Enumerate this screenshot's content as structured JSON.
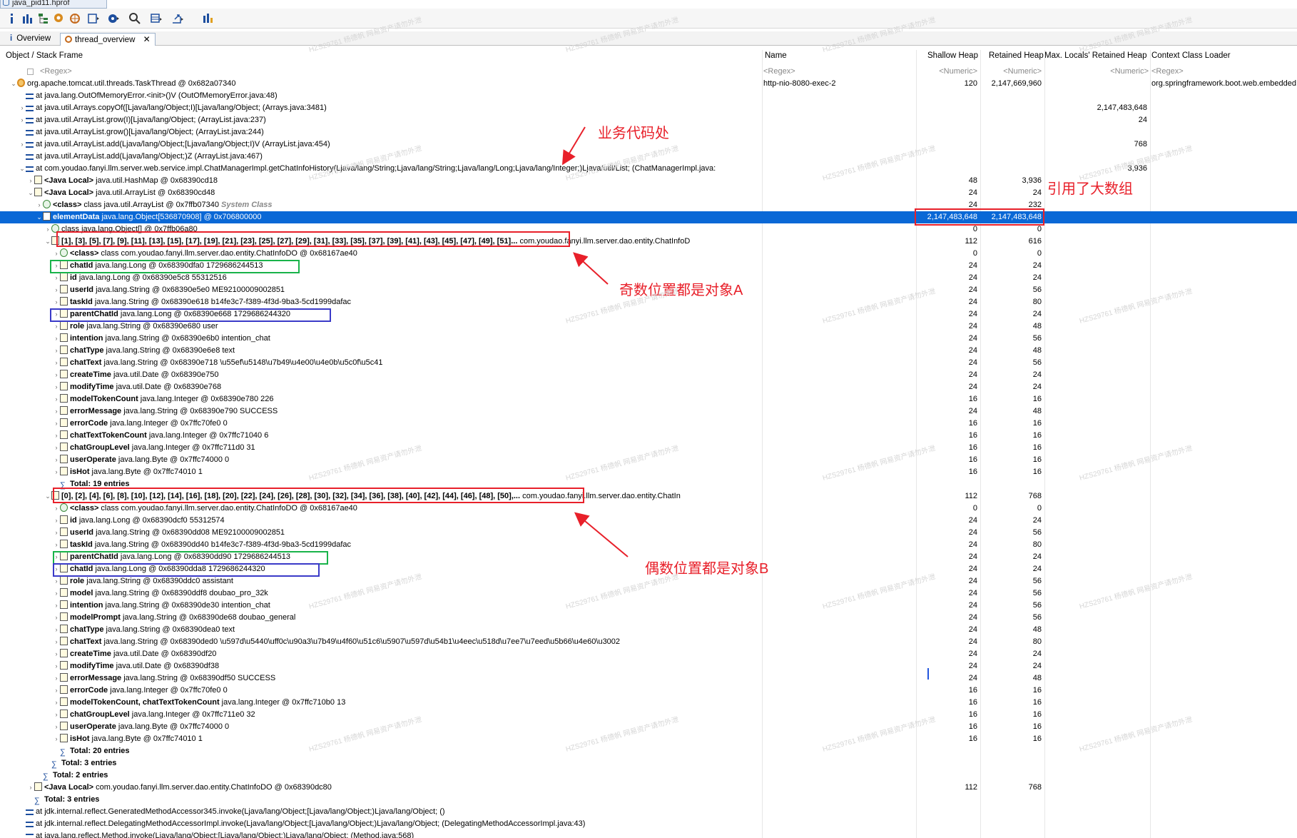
{
  "window_tab": "java_pid11.hprof",
  "tabs": [
    {
      "label": "Overview"
    },
    {
      "label": "thread_overview"
    }
  ],
  "columns": [
    "Object / Stack Frame",
    "Name",
    "Shallow Heap",
    "Retained Heap",
    "Max. Locals' Retained Heap",
    "Context Class Loader"
  ],
  "filter_row": [
    "<Regex>",
    "<Regex>",
    "<Numeric>",
    "<Numeric>",
    "<Numeric>",
    "<Regex>"
  ],
  "rows": [
    {
      "indent": 0,
      "tw": "v",
      "icon": "thread",
      "text": "org.apache.tomcat.util.threads.TaskThread @ 0x682a07340",
      "name": "http-nio-8080-exec-2",
      "shallow": "120",
      "retained": "2,147,669,960",
      "maxlocals": "",
      "loader": "org.springframework.boot.web.embedded.tomcat.TomcatEmbeddedWebappClassLoader"
    },
    {
      "indent": 1,
      "tw": "",
      "icon": "frame",
      "text": "at java.lang.OutOfMemoryError.<init>()V (OutOfMemoryError.java:48)",
      "name": "",
      "shallow": "",
      "retained": "",
      "maxlocals": "",
      "loader": ""
    },
    {
      "indent": 1,
      "tw": ">",
      "icon": "frame",
      "text": "at java.util.Arrays.copyOf([Ljava/lang/Object;I)[Ljava/lang/Object; (Arrays.java:3481)",
      "name": "",
      "shallow": "",
      "retained": "",
      "maxlocals": "2,147,483,648",
      "loader": ""
    },
    {
      "indent": 1,
      "tw": ">",
      "icon": "frame",
      "text": "at java.util.ArrayList.grow(I)[Ljava/lang/Object; (ArrayList.java:237)",
      "name": "",
      "shallow": "",
      "retained": "",
      "maxlocals": "24",
      "loader": ""
    },
    {
      "indent": 1,
      "tw": "",
      "icon": "frame",
      "text": "at java.util.ArrayList.grow()[Ljava/lang/Object; (ArrayList.java:244)",
      "name": "",
      "shallow": "",
      "retained": "",
      "maxlocals": "",
      "loader": ""
    },
    {
      "indent": 1,
      "tw": ">",
      "icon": "frame",
      "text": "at java.util.ArrayList.add(Ljava/lang/Object;[Ljava/lang/Object;I)V (ArrayList.java:454)",
      "name": "",
      "shallow": "",
      "retained": "",
      "maxlocals": "768",
      "loader": ""
    },
    {
      "indent": 1,
      "tw": "",
      "icon": "frame",
      "text": "at java.util.ArrayList.add(Ljava/lang/Object;)Z (ArrayList.java:467)",
      "name": "",
      "shallow": "",
      "retained": "",
      "maxlocals": "",
      "loader": ""
    },
    {
      "indent": 1,
      "tw": "v",
      "icon": "frame",
      "text": "at com.youdao.fanyi.llm.server.web.service.impl.ChatManagerImpl.getChatInfoHistory(Ljava/lang/String;Ljava/lang/String;Ljava/lang/Long;Ljava/lang/Integer;)Ljava/util/List; (ChatManagerImpl.java:",
      "name": "",
      "shallow": "",
      "retained": "",
      "maxlocals": "3,936",
      "loader": ""
    },
    {
      "indent": 2,
      "tw": ">",
      "icon": "obj",
      "bold": "<Java Local>",
      "text": " java.util.HashMap @ 0x68390cd18",
      "name": "",
      "shallow": "48",
      "retained": "3,936",
      "maxlocals": "",
      "loader": ""
    },
    {
      "indent": 2,
      "tw": "v",
      "icon": "obj",
      "bold": "<Java Local>",
      "text": " java.util.ArrayList @ 0x68390cd48",
      "name": "",
      "shallow": "24",
      "retained": "24",
      "maxlocals": "",
      "loader": ""
    },
    {
      "indent": 3,
      "tw": ">",
      "icon": "cls",
      "bold": "<class>",
      "text": " class java.util.ArrayList @ 0x7ffb07340 ",
      "sys": "System Class",
      "name": "",
      "shallow": "24",
      "retained": "232",
      "maxlocals": "",
      "loader": ""
    },
    {
      "indent": 3,
      "tw": "v",
      "icon": "arr",
      "bold": "elementData",
      "text": " java.lang.Object[536870908] @ 0x706800000",
      "name": "",
      "shallow": "2,147,483,648",
      "retained": "2,147,483,648",
      "maxlocals": "",
      "loader": "",
      "selected": true
    },
    {
      "indent": 4,
      "tw": ">",
      "icon": "cls",
      "text": "class java.lang.Object[] @ 0x7ffb06a80",
      "name": "",
      "shallow": "0",
      "retained": "0",
      "maxlocals": "",
      "loader": ""
    },
    {
      "indent": 4,
      "tw": "v",
      "icon": "obj",
      "bold": "[1], [3], [5], [7], [9], [11], [13], [15], [17], [19], [21], [23], [25], [27], [29], [31], [33], [35], [37], [39], [41], [43], [45], [47], [49], [51]...",
      "text": " com.youdao.fanyi.llm.server.dao.entity.ChatInfoD",
      "name": "",
      "shallow": "112",
      "retained": "616",
      "maxlocals": "",
      "loader": ""
    },
    {
      "indent": 5,
      "tw": ">",
      "icon": "cls",
      "bold": "<class>",
      "text": " class com.youdao.fanyi.llm.server.dao.entity.ChatInfoDO @ 0x68167ae40",
      "name": "",
      "shallow": "0",
      "retained": "0",
      "maxlocals": "",
      "loader": ""
    },
    {
      "indent": 5,
      "tw": ">",
      "icon": "obj",
      "bold": "chatId",
      "text": " java.lang.Long @ 0x68390dfa0  1729686244513",
      "name": "",
      "shallow": "24",
      "retained": "24",
      "maxlocals": "",
      "loader": ""
    },
    {
      "indent": 5,
      "tw": ">",
      "icon": "obj",
      "bold": "id",
      "text": " java.lang.Long @ 0x68390e5c8  55312516",
      "name": "",
      "shallow": "24",
      "retained": "24",
      "maxlocals": "",
      "loader": ""
    },
    {
      "indent": 5,
      "tw": ">",
      "icon": "obj",
      "bold": "userId",
      "text": " java.lang.String @ 0x68390e5e0  ME92100009002851",
      "name": "",
      "shallow": "24",
      "retained": "56",
      "maxlocals": "",
      "loader": ""
    },
    {
      "indent": 5,
      "tw": ">",
      "icon": "obj",
      "bold": "taskId",
      "text": " java.lang.String @ 0x68390e618  b14fe3c7-f389-4f3d-9ba3-5cd1999dafac",
      "name": "",
      "shallow": "24",
      "retained": "80",
      "maxlocals": "",
      "loader": ""
    },
    {
      "indent": 5,
      "tw": ">",
      "icon": "obj",
      "bold": "parentChatId",
      "text": " java.lang.Long @ 0x68390e668  1729686244320",
      "name": "",
      "shallow": "24",
      "retained": "24",
      "maxlocals": "",
      "loader": ""
    },
    {
      "indent": 5,
      "tw": ">",
      "icon": "obj",
      "bold": "role",
      "text": " java.lang.String @ 0x68390e680  user",
      "name": "",
      "shallow": "24",
      "retained": "48",
      "maxlocals": "",
      "loader": ""
    },
    {
      "indent": 5,
      "tw": ">",
      "icon": "obj",
      "bold": "intention",
      "text": " java.lang.String @ 0x68390e6b0  intention_chat",
      "name": "",
      "shallow": "24",
      "retained": "56",
      "maxlocals": "",
      "loader": ""
    },
    {
      "indent": 5,
      "tw": ">",
      "icon": "obj",
      "bold": "chatType",
      "text": " java.lang.String @ 0x68390e6e8  text",
      "name": "",
      "shallow": "24",
      "retained": "48",
      "maxlocals": "",
      "loader": ""
    },
    {
      "indent": 5,
      "tw": ">",
      "icon": "obj",
      "bold": "chatText",
      "text": " java.lang.String @ 0x68390e718  \\u55ef\\u5148\\u7b49\\u4e00\\u4e0b\\u5c0f\\u5c41",
      "name": "",
      "shallow": "24",
      "retained": "56",
      "maxlocals": "",
      "loader": ""
    },
    {
      "indent": 5,
      "tw": ">",
      "icon": "obj",
      "bold": "createTime",
      "text": " java.util.Date @ 0x68390e750",
      "name": "",
      "shallow": "24",
      "retained": "24",
      "maxlocals": "",
      "loader": ""
    },
    {
      "indent": 5,
      "tw": ">",
      "icon": "obj",
      "bold": "modifyTime",
      "text": " java.util.Date @ 0x68390e768",
      "name": "",
      "shallow": "24",
      "retained": "24",
      "maxlocals": "",
      "loader": ""
    },
    {
      "indent": 5,
      "tw": ">",
      "icon": "obj",
      "bold": "modelTokenCount",
      "text": " java.lang.Integer @ 0x68390e780  226",
      "name": "",
      "shallow": "16",
      "retained": "16",
      "maxlocals": "",
      "loader": ""
    },
    {
      "indent": 5,
      "tw": ">",
      "icon": "obj",
      "bold": "errorMessage",
      "text": " java.lang.String @ 0x68390e790  SUCCESS",
      "name": "",
      "shallow": "24",
      "retained": "48",
      "maxlocals": "",
      "loader": ""
    },
    {
      "indent": 5,
      "tw": ">",
      "icon": "obj",
      "bold": "errorCode",
      "text": " java.lang.Integer @ 0x7ffc70fe0  0",
      "name": "",
      "shallow": "16",
      "retained": "16",
      "maxlocals": "",
      "loader": ""
    },
    {
      "indent": 5,
      "tw": ">",
      "icon": "obj",
      "bold": "chatTextTokenCount",
      "text": " java.lang.Integer @ 0x7ffc71040  6",
      "name": "",
      "shallow": "16",
      "retained": "16",
      "maxlocals": "",
      "loader": ""
    },
    {
      "indent": 5,
      "tw": ">",
      "icon": "obj",
      "bold": "chatGroupLevel",
      "text": " java.lang.Integer @ 0x7ffc711d0  31",
      "name": "",
      "shallow": "16",
      "retained": "16",
      "maxlocals": "",
      "loader": ""
    },
    {
      "indent": 5,
      "tw": ">",
      "icon": "obj",
      "bold": "userOperate",
      "text": " java.lang.Byte @ 0x7ffc74000  0",
      "name": "",
      "shallow": "16",
      "retained": "16",
      "maxlocals": "",
      "loader": ""
    },
    {
      "indent": 5,
      "tw": ">",
      "icon": "obj",
      "bold": "isHot",
      "text": " java.lang.Byte @ 0x7ffc74010  1",
      "name": "",
      "shallow": "16",
      "retained": "16",
      "maxlocals": "",
      "loader": ""
    },
    {
      "indent": 5,
      "tw": "",
      "icon": "sum",
      "bold": "Total: 19 entries",
      "text": "",
      "name": "",
      "shallow": "",
      "retained": "",
      "maxlocals": "",
      "loader": ""
    },
    {
      "indent": 4,
      "tw": "v",
      "icon": "obj",
      "bold": "[0], [2], [4], [6], [8], [10], [12], [14], [16], [18], [20], [22], [24], [26], [28], [30], [32], [34], [36], [38], [40], [42], [44], [46], [48], [50],...",
      "text": " com.youdao.fanyi.llm.server.dao.entity.ChatIn",
      "name": "",
      "shallow": "112",
      "retained": "768",
      "maxlocals": "",
      "loader": ""
    },
    {
      "indent": 5,
      "tw": ">",
      "icon": "cls",
      "bold": "<class>",
      "text": " class com.youdao.fanyi.llm.server.dao.entity.ChatInfoDO @ 0x68167ae40",
      "name": "",
      "shallow": "0",
      "retained": "0",
      "maxlocals": "",
      "loader": ""
    },
    {
      "indent": 5,
      "tw": ">",
      "icon": "obj",
      "bold": "id",
      "text": " java.lang.Long @ 0x68390dcf0  55312574",
      "name": "",
      "shallow": "24",
      "retained": "24",
      "maxlocals": "",
      "loader": ""
    },
    {
      "indent": 5,
      "tw": ">",
      "icon": "obj",
      "bold": "userId",
      "text": " java.lang.String @ 0x68390dd08  ME92100009002851",
      "name": "",
      "shallow": "24",
      "retained": "56",
      "maxlocals": "",
      "loader": ""
    },
    {
      "indent": 5,
      "tw": ">",
      "icon": "obj",
      "bold": "taskId",
      "text": " java.lang.String @ 0x68390dd40  b14fe3c7-f389-4f3d-9ba3-5cd1999dafac",
      "name": "",
      "shallow": "24",
      "retained": "80",
      "maxlocals": "",
      "loader": ""
    },
    {
      "indent": 5,
      "tw": ">",
      "icon": "obj",
      "bold": "parentChatId",
      "text": " java.lang.Long @ 0x68390dd90  1729686244513",
      "name": "",
      "shallow": "24",
      "retained": "24",
      "maxlocals": "",
      "loader": ""
    },
    {
      "indent": 5,
      "tw": ">",
      "icon": "obj",
      "bold": "chatId",
      "text": " java.lang.Long @ 0x68390dda8  1729686244320",
      "name": "",
      "shallow": "24",
      "retained": "24",
      "maxlocals": "",
      "loader": ""
    },
    {
      "indent": 5,
      "tw": ">",
      "icon": "obj",
      "bold": "role",
      "text": " java.lang.String @ 0x68390ddc0  assistant",
      "name": "",
      "shallow": "24",
      "retained": "56",
      "maxlocals": "",
      "loader": ""
    },
    {
      "indent": 5,
      "tw": ">",
      "icon": "obj",
      "bold": "model",
      "text": " java.lang.String @ 0x68390ddf8  doubao_pro_32k",
      "name": "",
      "shallow": "24",
      "retained": "56",
      "maxlocals": "",
      "loader": ""
    },
    {
      "indent": 5,
      "tw": ">",
      "icon": "obj",
      "bold": "intention",
      "text": " java.lang.String @ 0x68390de30  intention_chat",
      "name": "",
      "shallow": "24",
      "retained": "56",
      "maxlocals": "",
      "loader": ""
    },
    {
      "indent": 5,
      "tw": ">",
      "icon": "obj",
      "bold": "modelPrompt",
      "text": " java.lang.String @ 0x68390de68  doubao_general",
      "name": "",
      "shallow": "24",
      "retained": "56",
      "maxlocals": "",
      "loader": ""
    },
    {
      "indent": 5,
      "tw": ">",
      "icon": "obj",
      "bold": "chatType",
      "text": " java.lang.String @ 0x68390dea0  text",
      "name": "",
      "shallow": "24",
      "retained": "48",
      "maxlocals": "",
      "loader": ""
    },
    {
      "indent": 5,
      "tw": ">",
      "icon": "obj",
      "bold": "chatText",
      "text": " java.lang.String @ 0x68390ded0  \\u597d\\u5440\\uff0c\\u90a3\\u7b49\\u4f60\\u51c6\\u5907\\u597d\\u54b1\\u4eec\\u518d\\u7ee7\\u7eed\\u5b66\\u4e60\\u3002",
      "name": "",
      "shallow": "24",
      "retained": "80",
      "maxlocals": "",
      "loader": ""
    },
    {
      "indent": 5,
      "tw": ">",
      "icon": "obj",
      "bold": "createTime",
      "text": " java.util.Date @ 0x68390df20",
      "name": "",
      "shallow": "24",
      "retained": "24",
      "maxlocals": "",
      "loader": ""
    },
    {
      "indent": 5,
      "tw": ">",
      "icon": "obj",
      "bold": "modifyTime",
      "text": " java.util.Date @ 0x68390df38",
      "name": "",
      "shallow": "24",
      "retained": "24",
      "maxlocals": "",
      "loader": ""
    },
    {
      "indent": 5,
      "tw": ">",
      "icon": "obj",
      "bold": "errorMessage",
      "text": " java.lang.String @ 0x68390df50  SUCCESS",
      "name": "",
      "shallow": "24",
      "retained": "48",
      "maxlocals": "",
      "loader": ""
    },
    {
      "indent": 5,
      "tw": ">",
      "icon": "obj",
      "bold": "errorCode",
      "text": " java.lang.Integer @ 0x7ffc70fe0  0",
      "name": "",
      "shallow": "16",
      "retained": "16",
      "maxlocals": "",
      "loader": ""
    },
    {
      "indent": 5,
      "tw": ">",
      "icon": "obj",
      "bold": "modelTokenCount, chatTextTokenCount",
      "text": " java.lang.Integer @ 0x7ffc710b0  13",
      "name": "",
      "shallow": "16",
      "retained": "16",
      "maxlocals": "",
      "loader": ""
    },
    {
      "indent": 5,
      "tw": ">",
      "icon": "obj",
      "bold": "chatGroupLevel",
      "text": " java.lang.Integer @ 0x7ffc711e0  32",
      "name": "",
      "shallow": "16",
      "retained": "16",
      "maxlocals": "",
      "loader": ""
    },
    {
      "indent": 5,
      "tw": ">",
      "icon": "obj",
      "bold": "userOperate",
      "text": " java.lang.Byte @ 0x7ffc74000  0",
      "name": "",
      "shallow": "16",
      "retained": "16",
      "maxlocals": "",
      "loader": ""
    },
    {
      "indent": 5,
      "tw": ">",
      "icon": "obj",
      "bold": "isHot",
      "text": " java.lang.Byte @ 0x7ffc74010  1",
      "name": "",
      "shallow": "16",
      "retained": "16",
      "maxlocals": "",
      "loader": ""
    },
    {
      "indent": 5,
      "tw": "",
      "icon": "sum",
      "bold": "Total: 20 entries",
      "text": "",
      "name": "",
      "shallow": "",
      "retained": "",
      "maxlocals": "",
      "loader": ""
    },
    {
      "indent": 4,
      "tw": "",
      "icon": "sum",
      "bold": "Total: 3 entries",
      "text": "",
      "name": "",
      "shallow": "",
      "retained": "",
      "maxlocals": "",
      "loader": ""
    },
    {
      "indent": 3,
      "tw": "",
      "icon": "sum",
      "bold": "Total: 2 entries",
      "text": "",
      "name": "",
      "shallow": "",
      "retained": "",
      "maxlocals": "",
      "loader": ""
    },
    {
      "indent": 2,
      "tw": ">",
      "icon": "obj",
      "bold": "<Java Local>",
      "text": " com.youdao.fanyi.llm.server.dao.entity.ChatInfoDO @ 0x68390dc80",
      "name": "",
      "shallow": "112",
      "retained": "768",
      "maxlocals": "",
      "loader": ""
    },
    {
      "indent": 2,
      "tw": "",
      "icon": "sum",
      "bold": "Total: 3 entries",
      "text": "",
      "name": "",
      "shallow": "",
      "retained": "",
      "maxlocals": "",
      "loader": ""
    },
    {
      "indent": 1,
      "tw": "",
      "icon": "frame",
      "text": "at jdk.internal.reflect.GeneratedMethodAccessor345.invoke(Ljava/lang/Object;[Ljava/lang/Object;)Ljava/lang/Object; ()",
      "name": "",
      "shallow": "",
      "retained": "",
      "maxlocals": "",
      "loader": ""
    },
    {
      "indent": 1,
      "tw": "",
      "icon": "frame",
      "text": "at jdk.internal.reflect.DelegatingMethodAccessorImpl.invoke(Ljava/lang/Object;[Ljava/lang/Object;)Ljava/lang/Object; (DelegatingMethodAccessorImpl.java:43)",
      "name": "",
      "shallow": "",
      "retained": "",
      "maxlocals": "",
      "loader": ""
    },
    {
      "indent": 1,
      "tw": "",
      "icon": "frame",
      "text": "at java.lang.reflect.Method.invoke(Ljava/lang/Object;[Ljava/lang/Object;)Ljava/lang/Object; (Method.java:568)",
      "name": "",
      "shallow": "",
      "retained": "",
      "maxlocals": "",
      "loader": ""
    }
  ],
  "annotations": {
    "business_code": "业务代码处",
    "big_array": "引用了大数组",
    "odd_objects": "奇数位置都是对象A",
    "even_objects": "偶数位置都是对象B"
  },
  "watermark": "HZS29761 杨德帆 网易资产请勿外泄",
  "colors": {
    "annotation": "#e8202a",
    "selection": "#0a68d6",
    "green_box": "#19b34a",
    "blue_box": "#3a3ac8"
  }
}
